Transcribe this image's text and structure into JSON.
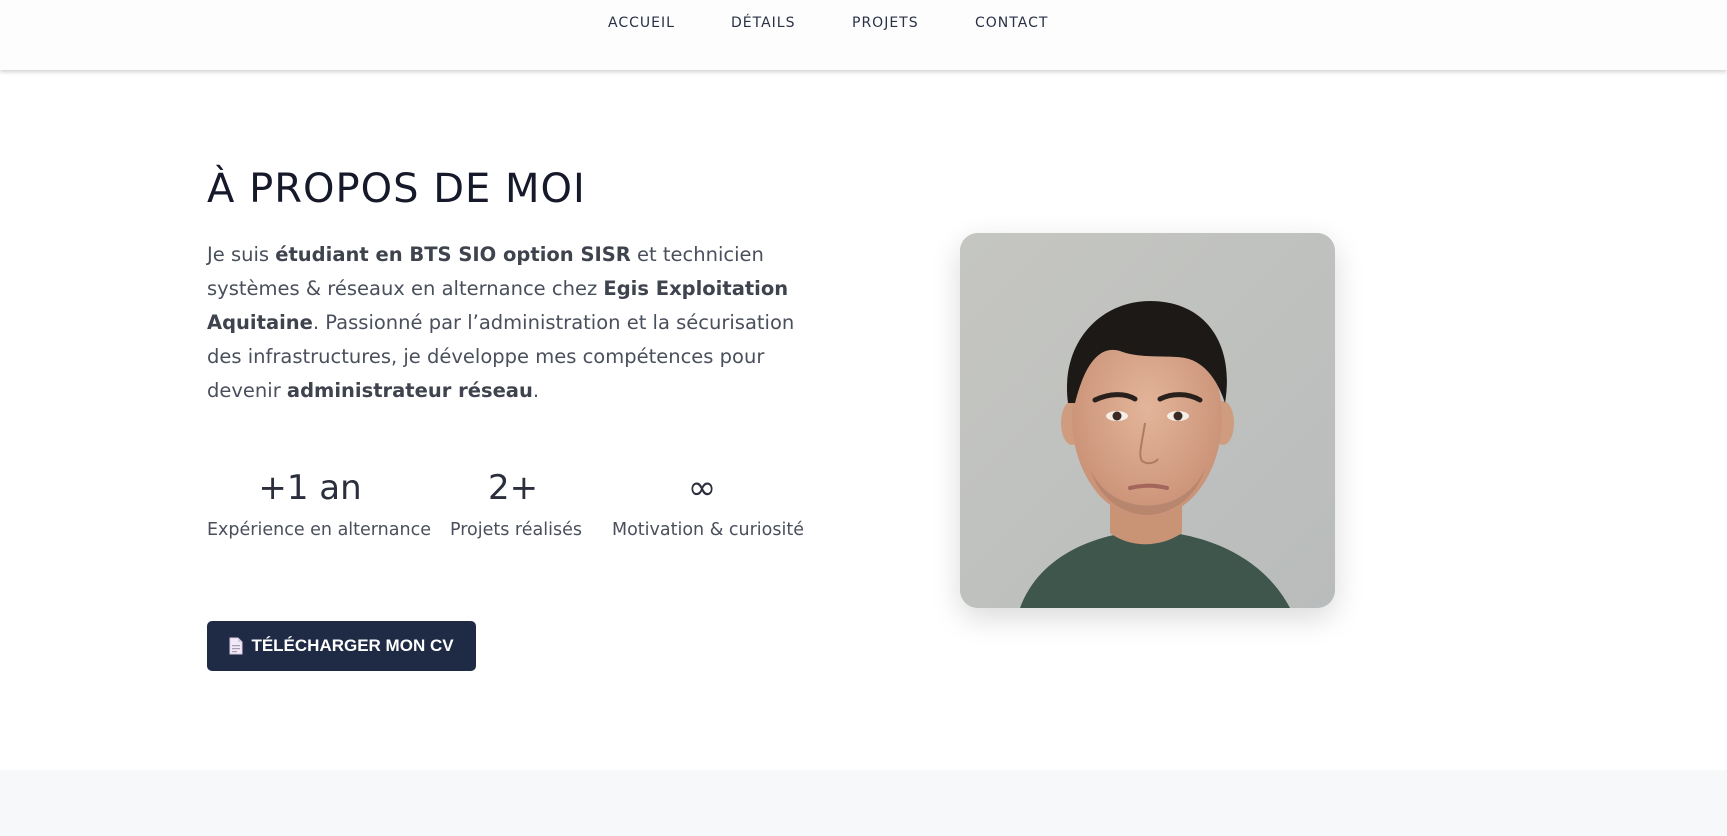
{
  "nav": {
    "links": [
      {
        "label": "ACCUEIL"
      },
      {
        "label": "DÉTAILS"
      },
      {
        "label": "PROJETS"
      },
      {
        "label": "CONTACT"
      }
    ]
  },
  "about": {
    "title": "À PROPOS DE MOI",
    "bio": {
      "t1": "Je suis ",
      "b1": "étudiant en BTS SIO option SISR",
      "t2": " et technicien systèmes & réseaux en alternance chez ",
      "b2": "Egis Exploitation Aquitaine",
      "t3": ". Passionné par l’administration et la sécurisation des infrastructures, je développe mes compétences pour devenir ",
      "b3": "administrateur réseau",
      "t4": "."
    },
    "stats": [
      {
        "value": "+1 an",
        "label": "Expérience en alternance"
      },
      {
        "value": "2+",
        "label": "Projets réalisés"
      },
      {
        "value": "∞",
        "label": "Motivation & curiosité"
      }
    ],
    "cv_button": {
      "icon": "document-icon",
      "label": "TÉLÉCHARGER MON CV"
    },
    "photo": {
      "subject": "portrait-photo"
    }
  },
  "colors": {
    "primary": "#1f2a44",
    "text": "#4a4f5c",
    "heading": "#16192a",
    "nav_text": "#2a3146",
    "next_section_bg": "#f7f8fa"
  }
}
